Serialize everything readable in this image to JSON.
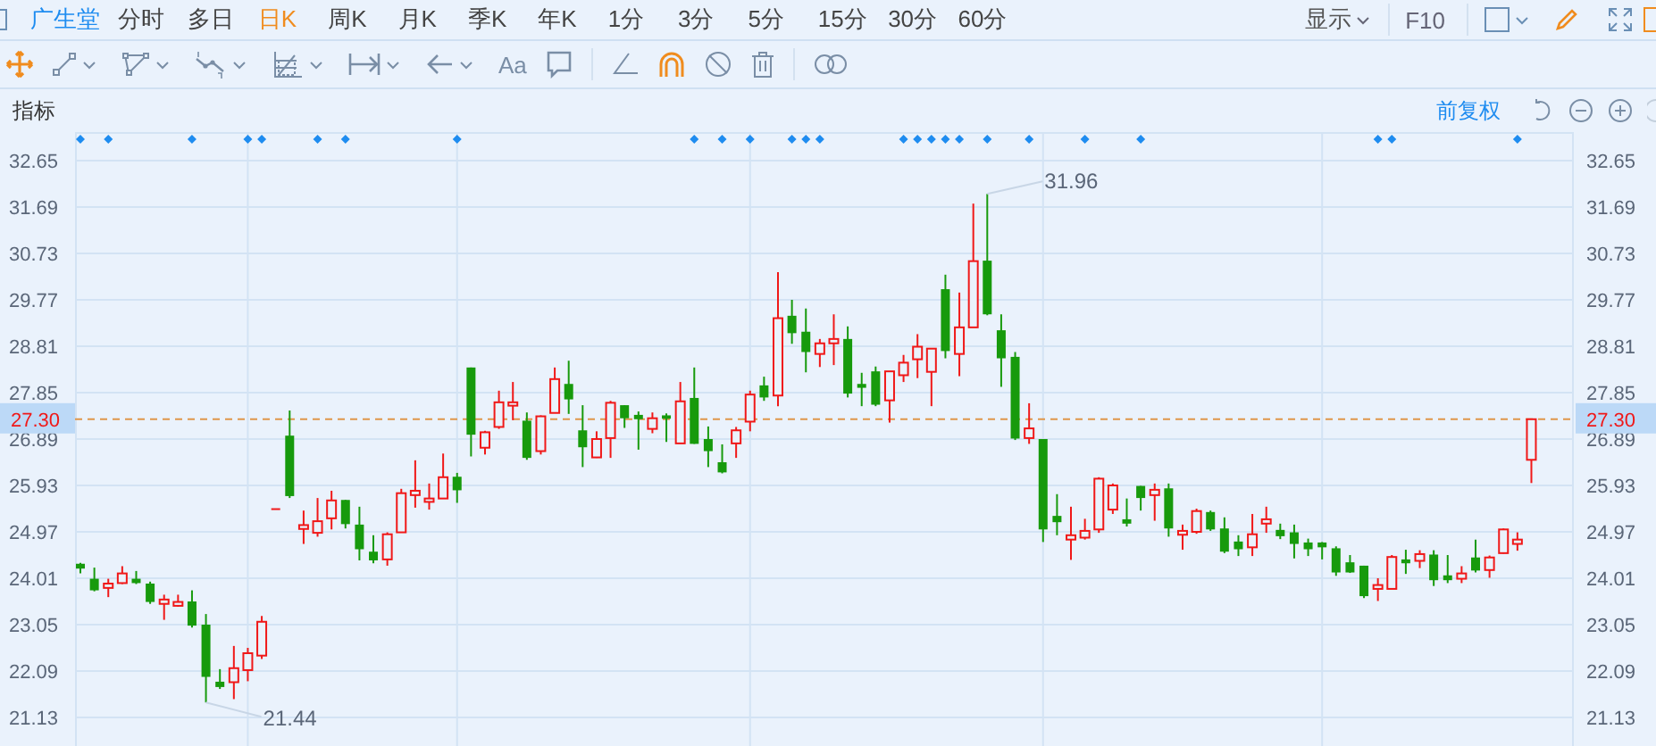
{
  "top_bar": {
    "stock_name": "广生堂",
    "periods": [
      {
        "label": "分时",
        "selected": false
      },
      {
        "label": "多日",
        "selected": false
      },
      {
        "label": "日K",
        "selected": true
      },
      {
        "label": "周K",
        "selected": false
      },
      {
        "label": "月K",
        "selected": false
      },
      {
        "label": "季K",
        "selected": false
      },
      {
        "label": "年K",
        "selected": false
      },
      {
        "label": "1分",
        "selected": false
      },
      {
        "label": "3分",
        "selected": false
      },
      {
        "label": "5分",
        "selected": false
      },
      {
        "label": "15分",
        "selected": false
      },
      {
        "label": "30分",
        "selected": false
      },
      {
        "label": "60分",
        "selected": false
      }
    ],
    "display_menu": "显示",
    "f10": "F10"
  },
  "toolbar": {
    "move_selected": true,
    "text_tool": "Aa",
    "magnet_on": true
  },
  "indicator_row": {
    "label": "指标",
    "adjust": "前复权"
  },
  "chart": {
    "left_axis": [
      "32.65",
      "31.69",
      "30.73",
      "29.77",
      "28.81",
      "27.85",
      "26.89",
      "25.93",
      "24.97",
      "24.01",
      "23.05",
      "22.09",
      "21.13"
    ],
    "right_axis": [
      "32.65",
      "31.69",
      "30.73",
      "29.77",
      "28.81",
      "27.85",
      "26.89",
      "25.93",
      "24.97",
      "24.01",
      "23.05",
      "22.09",
      "21.13"
    ],
    "price_line": {
      "left_label": "27.30",
      "right_label": "27.30"
    },
    "chart_data": {
      "type": "candlestick",
      "grid": true,
      "ylim": [
        20.54,
        33.24
      ],
      "yticks": [
        32.65,
        31.69,
        30.73,
        29.77,
        28.81,
        27.85,
        26.89,
        25.93,
        24.97,
        24.01,
        23.05,
        22.09,
        21.13
      ],
      "ref_lines": [
        {
          "axis": "y",
          "value": 27.3
        }
      ],
      "annotations": [
        "31.96",
        "21.44"
      ],
      "ohlc": [
        [
          24.31,
          24.33,
          24.11,
          24.21
        ],
        [
          24.0,
          24.23,
          23.74,
          23.76
        ],
        [
          23.81,
          24.0,
          23.62,
          23.9
        ],
        [
          23.91,
          24.26,
          23.89,
          24.11
        ],
        [
          24.0,
          24.16,
          23.89,
          23.91
        ],
        [
          23.9,
          23.94,
          23.48,
          23.52
        ],
        [
          23.48,
          23.67,
          23.15,
          23.57
        ],
        [
          23.44,
          23.67,
          23.42,
          23.52
        ],
        [
          23.53,
          23.76,
          22.99,
          23.03
        ],
        [
          23.05,
          23.27,
          21.44,
          21.97
        ],
        [
          21.87,
          22.13,
          21.72,
          21.76
        ],
        [
          21.86,
          22.61,
          21.51,
          22.15
        ],
        [
          22.11,
          22.57,
          21.88,
          22.46
        ],
        [
          22.41,
          23.23,
          22.34,
          23.11
        ],
        [
          25.44,
          25.44,
          25.44,
          25.44
        ],
        [
          26.96,
          27.48,
          25.67,
          25.71
        ],
        [
          25.03,
          25.41,
          24.72,
          25.11
        ],
        [
          24.95,
          25.67,
          24.87,
          25.19
        ],
        [
          25.25,
          25.82,
          25.02,
          25.62
        ],
        [
          25.63,
          25.63,
          25.04,
          25.13
        ],
        [
          25.12,
          25.49,
          24.38,
          24.61
        ],
        [
          24.56,
          24.9,
          24.32,
          24.38
        ],
        [
          24.4,
          24.96,
          24.27,
          24.92
        ],
        [
          24.96,
          25.86,
          24.96,
          25.77
        ],
        [
          25.73,
          26.45,
          25.47,
          25.82
        ],
        [
          25.59,
          25.97,
          25.43,
          25.66
        ],
        [
          25.66,
          26.59,
          25.66,
          26.1
        ],
        [
          26.11,
          26.19,
          25.57,
          25.83
        ],
        [
          28.37,
          28.37,
          26.53,
          26.98
        ],
        [
          26.71,
          27.06,
          26.57,
          27.03
        ],
        [
          27.14,
          27.89,
          27.1,
          27.65
        ],
        [
          27.58,
          28.07,
          27.28,
          27.65
        ],
        [
          27.27,
          27.44,
          26.46,
          26.5
        ],
        [
          26.64,
          27.38,
          26.57,
          27.36
        ],
        [
          27.43,
          28.37,
          27.43,
          28.13
        ],
        [
          28.03,
          28.51,
          27.41,
          27.71
        ],
        [
          27.07,
          27.59,
          26.31,
          26.72
        ],
        [
          26.51,
          27.05,
          26.5,
          26.89
        ],
        [
          26.91,
          27.68,
          26.5,
          27.64
        ],
        [
          27.59,
          27.59,
          27.12,
          27.32
        ],
        [
          27.39,
          27.46,
          26.67,
          27.3
        ],
        [
          27.1,
          27.44,
          27.01,
          27.32
        ],
        [
          27.38,
          27.42,
          26.83,
          27.31
        ],
        [
          26.8,
          28.07,
          26.8,
          27.67
        ],
        [
          27.74,
          28.37,
          26.79,
          26.79
        ],
        [
          26.89,
          27.15,
          26.31,
          26.64
        ],
        [
          26.41,
          26.78,
          26.18,
          26.2
        ],
        [
          26.8,
          27.14,
          26.5,
          27.07
        ],
        [
          27.25,
          27.89,
          27.05,
          27.81
        ],
        [
          28.0,
          28.18,
          27.68,
          27.75
        ],
        [
          27.79,
          30.34,
          27.57,
          29.39
        ],
        [
          29.44,
          29.77,
          28.86,
          29.08
        ],
        [
          29.11,
          29.59,
          28.27,
          28.69
        ],
        [
          28.65,
          28.96,
          28.38,
          28.87
        ],
        [
          28.87,
          29.47,
          28.42,
          28.96
        ],
        [
          28.96,
          29.22,
          27.75,
          27.83
        ],
        [
          28.03,
          28.26,
          27.57,
          27.95
        ],
        [
          28.29,
          28.39,
          27.57,
          27.6
        ],
        [
          27.69,
          28.29,
          27.23,
          28.29
        ],
        [
          28.21,
          28.63,
          28.07,
          28.47
        ],
        [
          28.54,
          29.06,
          28.15,
          28.8
        ],
        [
          28.28,
          28.76,
          27.57,
          28.76
        ],
        [
          29.99,
          30.29,
          28.56,
          28.71
        ],
        [
          28.65,
          29.92,
          28.19,
          29.2
        ],
        [
          29.2,
          31.76,
          29.2,
          30.57
        ],
        [
          30.58,
          31.96,
          29.45,
          29.47
        ],
        [
          29.14,
          29.47,
          27.97,
          28.56
        ],
        [
          28.59,
          28.69,
          26.87,
          26.9
        ],
        [
          26.91,
          27.63,
          26.79,
          27.11
        ],
        [
          26.89,
          26.89,
          24.76,
          25.02
        ],
        [
          25.3,
          25.75,
          24.9,
          25.17
        ],
        [
          24.81,
          25.49,
          24.39,
          24.9
        ],
        [
          24.85,
          25.24,
          24.81,
          24.99
        ],
        [
          25.02,
          26.1,
          24.95,
          26.07
        ],
        [
          25.43,
          25.97,
          25.34,
          25.93
        ],
        [
          25.23,
          25.66,
          25.08,
          25.14
        ],
        [
          25.92,
          25.92,
          25.41,
          25.67
        ],
        [
          25.73,
          25.97,
          25.2,
          25.84
        ],
        [
          25.87,
          25.97,
          24.87,
          25.04
        ],
        [
          24.91,
          25.12,
          24.6,
          24.99
        ],
        [
          24.97,
          25.45,
          24.93,
          25.4
        ],
        [
          25.38,
          25.41,
          24.99,
          25.02
        ],
        [
          25.04,
          25.27,
          24.53,
          24.56
        ],
        [
          24.77,
          24.9,
          24.47,
          24.61
        ],
        [
          24.65,
          25.34,
          24.47,
          24.92
        ],
        [
          25.14,
          25.49,
          24.95,
          25.23
        ],
        [
          25.01,
          25.14,
          24.82,
          24.88
        ],
        [
          24.96,
          25.12,
          24.42,
          24.72
        ],
        [
          24.75,
          24.83,
          24.47,
          24.61
        ],
        [
          24.75,
          24.76,
          24.4,
          24.65
        ],
        [
          24.63,
          24.67,
          24.06,
          24.13
        ],
        [
          24.34,
          24.49,
          24.12,
          24.13
        ],
        [
          24.27,
          24.27,
          23.6,
          23.64
        ],
        [
          23.79,
          24.01,
          23.54,
          23.87
        ],
        [
          23.79,
          24.49,
          23.79,
          24.45
        ],
        [
          24.4,
          24.6,
          24.1,
          24.32
        ],
        [
          24.37,
          24.59,
          24.22,
          24.51
        ],
        [
          24.5,
          24.59,
          23.85,
          23.97
        ],
        [
          24.07,
          24.49,
          23.91,
          23.97
        ],
        [
          24.0,
          24.26,
          23.91,
          24.11
        ],
        [
          24.44,
          24.81,
          24.13,
          24.17
        ],
        [
          24.18,
          24.48,
          24.02,
          24.44
        ],
        [
          24.53,
          25.04,
          24.52,
          25.02
        ],
        [
          24.72,
          24.96,
          24.58,
          24.81
        ],
        [
          26.46,
          27.3,
          25.98,
          27.3
        ]
      ]
    }
  }
}
